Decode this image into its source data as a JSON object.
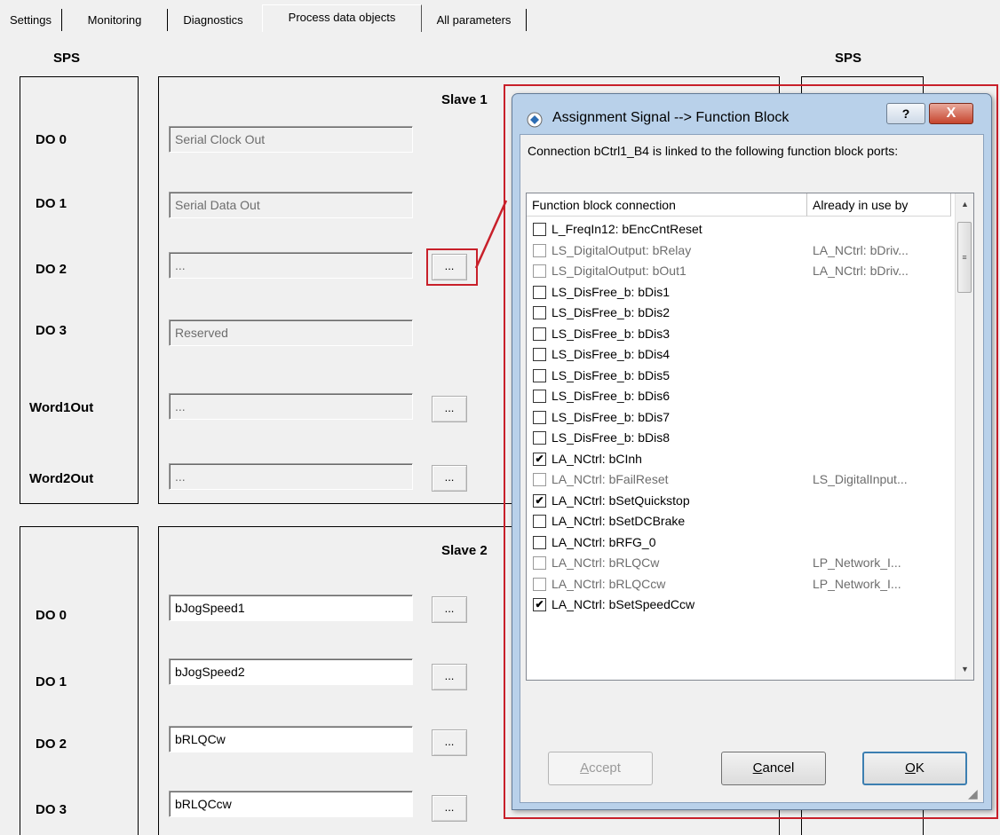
{
  "tabs": [
    "Settings",
    "Monitoring",
    "Diagnostics",
    "Process data objects",
    "All parameters"
  ],
  "active_tab": "Process data objects",
  "left_header": "SPS",
  "right_header": "SPS",
  "slave1": {
    "title": "Slave 1",
    "rows": [
      {
        "label": "DO 0",
        "value": "Serial Clock Out"
      },
      {
        "label": "DO 1",
        "value": "Serial Data Out"
      },
      {
        "label": "DO 2",
        "value": "...",
        "button": "..."
      },
      {
        "label": "DO 3",
        "value": "Reserved"
      },
      {
        "label": "Word1Out",
        "value": "...",
        "button": "..."
      },
      {
        "label": "Word2Out",
        "value": "...",
        "button": "..."
      }
    ]
  },
  "slave2": {
    "title": "Slave 2",
    "rows": [
      {
        "label": "DO 0",
        "value": "bJogSpeed1",
        "button": "..."
      },
      {
        "label": "DO 1",
        "value": "bJogSpeed2",
        "button": "..."
      },
      {
        "label": "DO 2",
        "value": "bRLQCw",
        "button": "..."
      },
      {
        "label": "DO 3",
        "value": "bRLQCcw",
        "button": "..."
      }
    ]
  },
  "dialog": {
    "title": "Assignment Signal --> Function Block",
    "help": "?",
    "close": "X",
    "message": "Connection bCtrl1_B4 is linked to the following function block ports:",
    "col_connection": "Function block connection",
    "col_in_use": "Already in use by",
    "items": [
      {
        "name": "L_FreqIn12: bEncCntReset",
        "checked": false,
        "enabled": true,
        "used_by": ""
      },
      {
        "name": "LS_DigitalOutput: bRelay",
        "checked": false,
        "enabled": false,
        "used_by": "LA_NCtrl: bDriv..."
      },
      {
        "name": "LS_DigitalOutput: bOut1",
        "checked": false,
        "enabled": false,
        "used_by": "LA_NCtrl: bDriv..."
      },
      {
        "name": "LS_DisFree_b: bDis1",
        "checked": false,
        "enabled": true,
        "used_by": ""
      },
      {
        "name": "LS_DisFree_b: bDis2",
        "checked": false,
        "enabled": true,
        "used_by": ""
      },
      {
        "name": "LS_DisFree_b: bDis3",
        "checked": false,
        "enabled": true,
        "used_by": ""
      },
      {
        "name": "LS_DisFree_b: bDis4",
        "checked": false,
        "enabled": true,
        "used_by": ""
      },
      {
        "name": "LS_DisFree_b: bDis5",
        "checked": false,
        "enabled": true,
        "used_by": ""
      },
      {
        "name": "LS_DisFree_b: bDis6",
        "checked": false,
        "enabled": true,
        "used_by": ""
      },
      {
        "name": "LS_DisFree_b: bDis7",
        "checked": false,
        "enabled": true,
        "used_by": ""
      },
      {
        "name": "LS_DisFree_b: bDis8",
        "checked": false,
        "enabled": true,
        "used_by": ""
      },
      {
        "name": "LA_NCtrl: bCInh",
        "checked": true,
        "enabled": true,
        "used_by": ""
      },
      {
        "name": "LA_NCtrl: bFailReset",
        "checked": false,
        "enabled": false,
        "used_by": "LS_DigitalInput..."
      },
      {
        "name": "LA_NCtrl: bSetQuickstop",
        "checked": true,
        "enabled": true,
        "used_by": ""
      },
      {
        "name": "LA_NCtrl: bSetDCBrake",
        "checked": false,
        "enabled": true,
        "used_by": ""
      },
      {
        "name": "LA_NCtrl: bRFG_0",
        "checked": false,
        "enabled": true,
        "used_by": ""
      },
      {
        "name": "LA_NCtrl: bRLQCw",
        "checked": false,
        "enabled": false,
        "used_by": "LP_Network_I..."
      },
      {
        "name": "LA_NCtrl: bRLQCcw",
        "checked": false,
        "enabled": false,
        "used_by": "LP_Network_I..."
      },
      {
        "name": "LA_NCtrl: bSetSpeedCcw",
        "checked": true,
        "enabled": true,
        "used_by": ""
      }
    ],
    "buttons": {
      "accept": "Accept",
      "cancel": "Cancel",
      "ok": "OK"
    }
  }
}
